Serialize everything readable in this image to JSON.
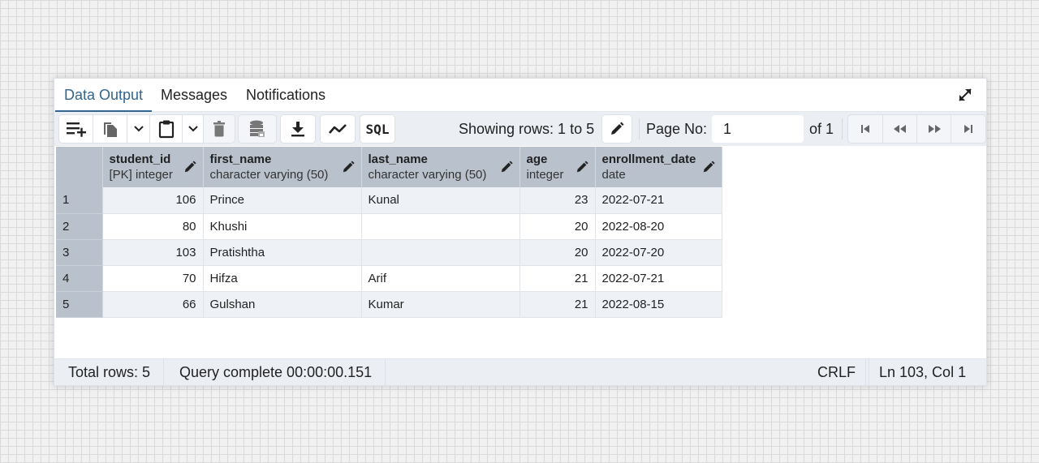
{
  "tabs": [
    {
      "label": "Data Output",
      "active": true
    },
    {
      "label": "Messages",
      "active": false
    },
    {
      "label": "Notifications",
      "active": false
    }
  ],
  "toolbar": {
    "icons": {
      "add_row": "add-row-icon",
      "copy": "copy-icon",
      "paste": "paste-icon",
      "delete": "delete-icon",
      "save_data": "save-data-icon",
      "download": "download-icon",
      "graph": "graph-icon",
      "sql": "SQL"
    },
    "showing_rows": "Showing rows: 1 to 5",
    "page_label": "Page No:",
    "page_value": "1",
    "page_of": "of 1"
  },
  "grid": {
    "columns": [
      {
        "name": "student_id",
        "type": "[PK] integer"
      },
      {
        "name": "first_name",
        "type": "character varying (50)"
      },
      {
        "name": "last_name",
        "type": "character varying (50)"
      },
      {
        "name": "age",
        "type": "integer"
      },
      {
        "name": "enrollment_date",
        "type": "date"
      }
    ],
    "rows": [
      {
        "n": "1",
        "student_id": "106",
        "first_name": "Prince",
        "last_name": "Kunal",
        "age": "23",
        "enrollment_date": "2022-07-21"
      },
      {
        "n": "2",
        "student_id": "80",
        "first_name": "Khushi",
        "last_name": "",
        "age": "20",
        "enrollment_date": "2022-08-20"
      },
      {
        "n": "3",
        "student_id": "103",
        "first_name": "Pratishtha",
        "last_name": "",
        "age": "20",
        "enrollment_date": "2022-07-20"
      },
      {
        "n": "4",
        "student_id": "70",
        "first_name": "Hifza",
        "last_name": "Arif",
        "age": "21",
        "enrollment_date": "2022-07-21"
      },
      {
        "n": "5",
        "student_id": "66",
        "first_name": "Gulshan",
        "last_name": "Kumar",
        "age": "21",
        "enrollment_date": "2022-08-15"
      }
    ]
  },
  "status": {
    "total_rows": "Total rows: 5",
    "query": "Query complete 00:00:00.151",
    "eol": "CRLF",
    "position": "Ln 103, Col 1"
  },
  "colors": {
    "accent": "#326690",
    "header_bg": "#b9c1cd",
    "toolbar_bg": "#ebeef3",
    "odd_row_bg": "#eef2f7"
  }
}
